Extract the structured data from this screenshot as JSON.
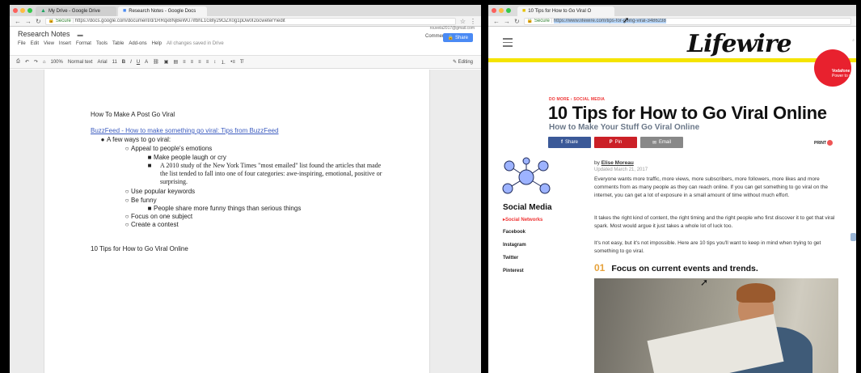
{
  "left_window": {
    "tabs": [
      {
        "label": "My Drive - Google Drive",
        "active": false
      },
      {
        "label": "Research Notes - Google Docs",
        "active": true
      }
    ],
    "url_secure": "Secure",
    "url": "https://docs.google.com/document/d/1RRqx8NjBeWU7ifbhL1G8ly29OZX0g1pDw0I2ocweterYiedit",
    "doc_title": "Research Notes",
    "menu": [
      "File",
      "Edit",
      "View",
      "Insert",
      "Format",
      "Tools",
      "Table",
      "Add-ons",
      "Help"
    ],
    "saved_status": "All changes saved in Drive",
    "account": "rouvela2017@gmail.com",
    "comments_label": "Comments",
    "share_label": "Share",
    "toolbar": {
      "zoom": "100%",
      "style": "Normal text",
      "font": "Arial",
      "size": "11",
      "mode": "Editing"
    },
    "document": {
      "heading": "How To Make A Post Go Viral",
      "link": "BuzzFeed - How to make something go viral: Tips from BuzzFeed",
      "l1": "A few ways to go viral:",
      "l2a": "Appeal to people's emotions",
      "l3a": "Make people laugh or cry",
      "l3b": "A 2010 study of the New York Times \"most emailed\" list found the articles that made the list tended to fall into one of four categories: awe-inspiring, emotional, positive or surprising.",
      "l2b": "Use popular keywords",
      "l2c": "Be funny",
      "l3c": "People share more funny things than serious things",
      "l2d": "Focus on one subject",
      "l2e": "Create a contest",
      "footer_line": "10 Tips for How to Go Viral Online"
    }
  },
  "right_window": {
    "tab": "10 Tips for How to Go Viral O",
    "url_secure": "Secure",
    "url": "https://www.lifewire.com/tips-for-going-viral-3486238",
    "logo": "Lifewire",
    "ad_brand": "Vodafone",
    "ad_tag": "Power to you",
    "breadcrumb": "DO MORE  ›  SOCIAL MEDIA",
    "title": "10 Tips for How to Go Viral Online",
    "subtitle": "How to Make Your Stuff Go Viral Online",
    "share_buttons": [
      "Share",
      "Pin",
      "Email"
    ],
    "print_label": "PRINT",
    "sidebar": {
      "title": "Social Media",
      "items": [
        "Social Networks",
        "Facebook",
        "Instagram",
        "Twitter",
        "Pinterest"
      ]
    },
    "byline_prefix": "by",
    "author": "Elise Moreau",
    "updated": "Updated March 21, 2017",
    "para1": "Everyone wants more traffic, more views, more subscribers, more followers, more likes and more comments from as many people as they can reach online. If you can get something to go viral on the internet, you can get a lot of exposure in a small amount of time without much effort.",
    "para2": "It takes the right kind of content, the right timing and the right people who first discover it to get that viral spark. Most would argue it just takes a whole lot of luck too.",
    "para3": "It's not easy, but it's not impossible. Here are 10 tips you'll want to keep in mind when trying to get something to go viral.",
    "section_num": "01",
    "section_title": "Focus on current events and trends."
  },
  "colors": {
    "facebook": "#3b5998",
    "pinterest": "#cb2027",
    "email": "#888888",
    "lifewire_yellow": "#f5e400",
    "accent_red": "#e33333"
  }
}
